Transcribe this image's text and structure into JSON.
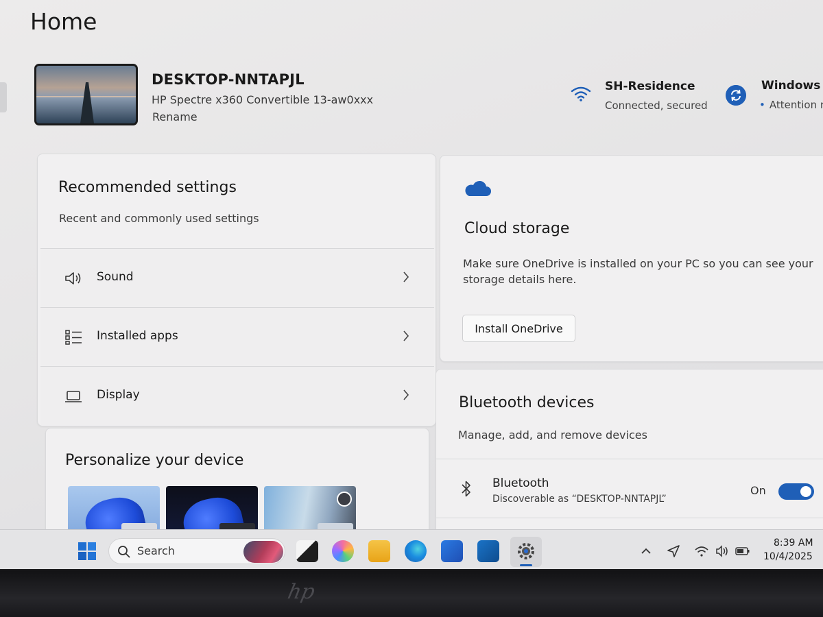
{
  "page": {
    "title": "Home"
  },
  "device": {
    "name": "DESKTOP-NNTAPJL",
    "model": "HP Spectre x360 Convertible 13-aw0xxx",
    "rename_label": "Rename"
  },
  "network": {
    "name": "SH-Residence",
    "status": "Connected, secured",
    "icon": "wifi-icon"
  },
  "windows_update": {
    "title": "Windows U",
    "status": "Attention r",
    "icon": "sync-icon"
  },
  "recommended": {
    "title": "Recommended settings",
    "subtitle": "Recent and commonly used settings",
    "items": [
      {
        "label": "Sound",
        "icon": "speaker-icon"
      },
      {
        "label": "Installed apps",
        "icon": "apps-list-icon"
      },
      {
        "label": "Display",
        "icon": "laptop-icon"
      }
    ]
  },
  "personalize": {
    "title": "Personalize your device"
  },
  "cloud": {
    "title": "Cloud storage",
    "description": "Make sure OneDrive is installed on your PC so you can see your storage details here.",
    "button_label": "Install OneDrive",
    "icon": "cloud-icon"
  },
  "bluetooth": {
    "title": "Bluetooth devices",
    "subtitle": "Manage, add, and remove devices",
    "row_name": "Bluetooth",
    "row_desc": "Discoverable as “DESKTOP-NNTAPJL”",
    "state": "On"
  },
  "taskbar": {
    "search_label": "Search",
    "time": "8:39 AM",
    "date": "10/4/2025"
  },
  "colors": {
    "accent": "#1f5fb7"
  }
}
